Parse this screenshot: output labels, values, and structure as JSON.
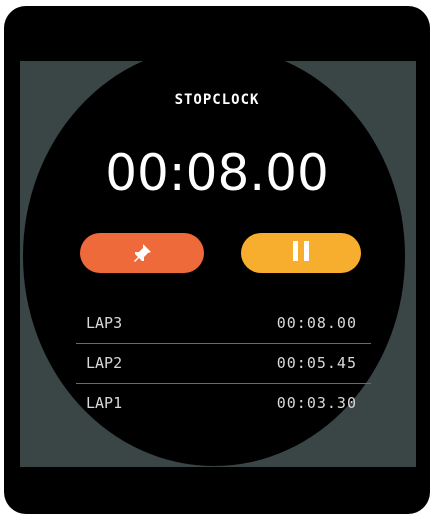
{
  "app": {
    "title": "STOPCLOCK"
  },
  "timer": {
    "elapsed": "00:08.00"
  },
  "controls": {
    "lap_icon": "pin-icon",
    "pause_icon": "pause-icon",
    "lap_color": "#ef6a3a",
    "pause_color": "#f7ad2d"
  },
  "laps": [
    {
      "label": "LAP3",
      "time": "00:08.00"
    },
    {
      "label": "LAP2",
      "time": "00:05.45"
    },
    {
      "label": "LAP1",
      "time": "00:03.30"
    }
  ],
  "colors": {
    "bezel": "#000000",
    "screen_bg": "#3a4546",
    "text": "#ffffff"
  }
}
